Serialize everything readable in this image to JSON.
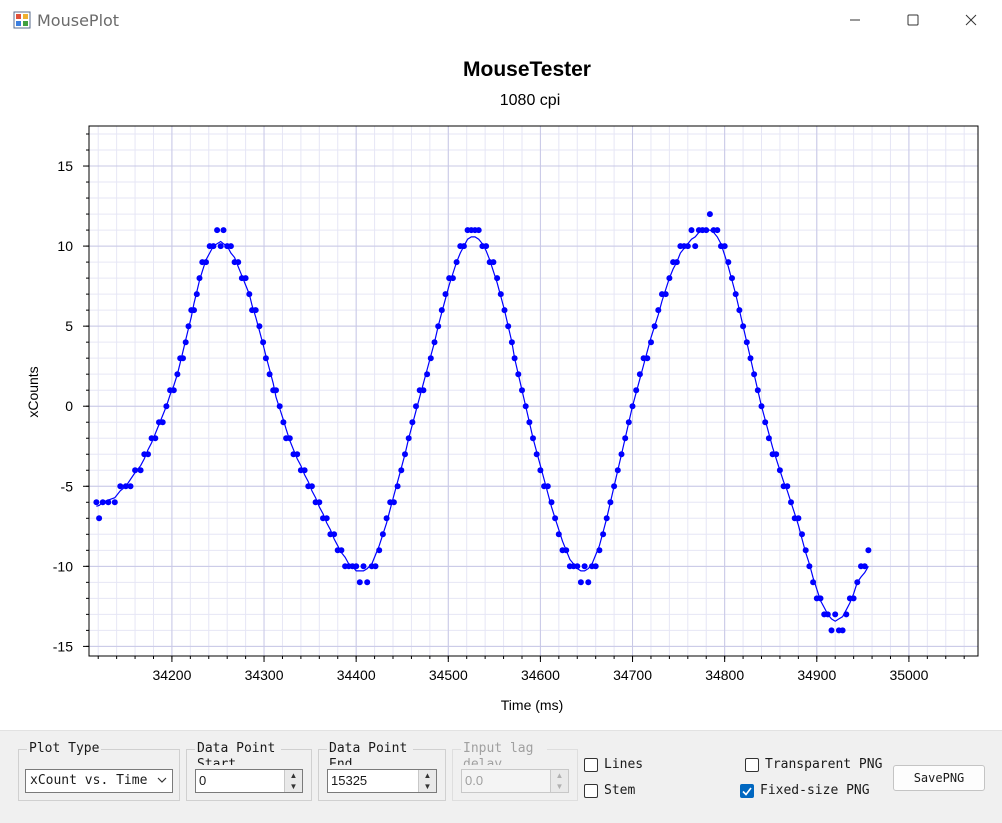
{
  "window": {
    "title": "MousePlot"
  },
  "chart_data": {
    "type": "scatter",
    "title": "MouseTester",
    "subtitle": "1080 cpi",
    "xlabel": "Time (ms)",
    "ylabel": "xCounts",
    "xlim": [
      34110,
      35075
    ],
    "ylim": [
      -15.6,
      17.5
    ],
    "xticks": [
      34200,
      34300,
      34400,
      34500,
      34600,
      34700,
      34800,
      34900,
      35000
    ],
    "yticks": [
      -15,
      -10,
      -5,
      0,
      5,
      10,
      15
    ],
    "grid": true,
    "series": [
      {
        "color": "#0000ff",
        "points": [
          [
            34118,
            -6
          ],
          [
            34121,
            -7
          ],
          [
            34125,
            -6
          ],
          [
            34131,
            -6
          ],
          [
            34138,
            -6
          ],
          [
            34144,
            -5
          ],
          [
            34150,
            -5
          ],
          [
            34155,
            -5
          ],
          [
            34160,
            -4
          ],
          [
            34166,
            -4
          ],
          [
            34170,
            -3
          ],
          [
            34174,
            -3
          ],
          [
            34178,
            -2
          ],
          [
            34182,
            -2
          ],
          [
            34186,
            -1
          ],
          [
            34190,
            -1
          ],
          [
            34194,
            0
          ],
          [
            34198,
            1
          ],
          [
            34202,
            1
          ],
          [
            34206,
            2
          ],
          [
            34209,
            3
          ],
          [
            34212,
            3
          ],
          [
            34215,
            4
          ],
          [
            34218,
            5
          ],
          [
            34221,
            6
          ],
          [
            34224,
            6
          ],
          [
            34227,
            7
          ],
          [
            34230,
            8
          ],
          [
            34233,
            9
          ],
          [
            34237,
            9
          ],
          [
            34241,
            10
          ],
          [
            34245,
            10
          ],
          [
            34249,
            11
          ],
          [
            34253,
            10
          ],
          [
            34256,
            11
          ],
          [
            34260,
            10
          ],
          [
            34264,
            10
          ],
          [
            34268,
            9
          ],
          [
            34272,
            9
          ],
          [
            34276,
            8
          ],
          [
            34280,
            8
          ],
          [
            34284,
            7
          ],
          [
            34287,
            6
          ],
          [
            34291,
            6
          ],
          [
            34295,
            5
          ],
          [
            34299,
            4
          ],
          [
            34302,
            3
          ],
          [
            34306,
            2
          ],
          [
            34310,
            1
          ],
          [
            34313,
            1
          ],
          [
            34317,
            0
          ],
          [
            34321,
            -1
          ],
          [
            34324,
            -2
          ],
          [
            34328,
            -2
          ],
          [
            34332,
            -3
          ],
          [
            34336,
            -3
          ],
          [
            34340,
            -4
          ],
          [
            34344,
            -4
          ],
          [
            34348,
            -5
          ],
          [
            34352,
            -5
          ],
          [
            34356,
            -6
          ],
          [
            34360,
            -6
          ],
          [
            34364,
            -7
          ],
          [
            34368,
            -7
          ],
          [
            34372,
            -8
          ],
          [
            34376,
            -8
          ],
          [
            34380,
            -9
          ],
          [
            34384,
            -9
          ],
          [
            34388,
            -10
          ],
          [
            34392,
            -10
          ],
          [
            34396,
            -10
          ],
          [
            34400,
            -10
          ],
          [
            34404,
            -11
          ],
          [
            34408,
            -10
          ],
          [
            34412,
            -11
          ],
          [
            34417,
            -10
          ],
          [
            34421,
            -10
          ],
          [
            34425,
            -9
          ],
          [
            34429,
            -8
          ],
          [
            34433,
            -7
          ],
          [
            34437,
            -6
          ],
          [
            34441,
            -6
          ],
          [
            34445,
            -5
          ],
          [
            34449,
            -4
          ],
          [
            34453,
            -3
          ],
          [
            34457,
            -2
          ],
          [
            34461,
            -1
          ],
          [
            34465,
            0
          ],
          [
            34469,
            1
          ],
          [
            34473,
            1
          ],
          [
            34477,
            2
          ],
          [
            34481,
            3
          ],
          [
            34485,
            4
          ],
          [
            34489,
            5
          ],
          [
            34493,
            6
          ],
          [
            34497,
            7
          ],
          [
            34501,
            8
          ],
          [
            34505,
            8
          ],
          [
            34509,
            9
          ],
          [
            34513,
            10
          ],
          [
            34517,
            10
          ],
          [
            34521,
            11
          ],
          [
            34525,
            11
          ],
          [
            34529,
            11
          ],
          [
            34533,
            11
          ],
          [
            34537,
            10
          ],
          [
            34541,
            10
          ],
          [
            34545,
            9
          ],
          [
            34549,
            9
          ],
          [
            34553,
            8
          ],
          [
            34557,
            7
          ],
          [
            34561,
            6
          ],
          [
            34565,
            5
          ],
          [
            34569,
            4
          ],
          [
            34572,
            3
          ],
          [
            34576,
            2
          ],
          [
            34580,
            1
          ],
          [
            34584,
            0
          ],
          [
            34588,
            -1
          ],
          [
            34592,
            -2
          ],
          [
            34596,
            -3
          ],
          [
            34600,
            -4
          ],
          [
            34604,
            -5
          ],
          [
            34608,
            -5
          ],
          [
            34612,
            -6
          ],
          [
            34616,
            -7
          ],
          [
            34620,
            -8
          ],
          [
            34624,
            -9
          ],
          [
            34628,
            -9
          ],
          [
            34632,
            -10
          ],
          [
            34636,
            -10
          ],
          [
            34640,
            -10
          ],
          [
            34644,
            -11
          ],
          [
            34648,
            -10
          ],
          [
            34652,
            -11
          ],
          [
            34656,
            -10
          ],
          [
            34660,
            -10
          ],
          [
            34664,
            -9
          ],
          [
            34668,
            -8
          ],
          [
            34672,
            -7
          ],
          [
            34676,
            -6
          ],
          [
            34680,
            -5
          ],
          [
            34684,
            -4
          ],
          [
            34688,
            -3
          ],
          [
            34692,
            -2
          ],
          [
            34696,
            -1
          ],
          [
            34700,
            0
          ],
          [
            34704,
            1
          ],
          [
            34708,
            2
          ],
          [
            34712,
            3
          ],
          [
            34716,
            3
          ],
          [
            34720,
            4
          ],
          [
            34724,
            5
          ],
          [
            34728,
            6
          ],
          [
            34732,
            7
          ],
          [
            34736,
            7
          ],
          [
            34740,
            8
          ],
          [
            34744,
            9
          ],
          [
            34748,
            9
          ],
          [
            34752,
            10
          ],
          [
            34756,
            10
          ],
          [
            34760,
            10
          ],
          [
            34764,
            11
          ],
          [
            34768,
            10
          ],
          [
            34772,
            11
          ],
          [
            34776,
            11
          ],
          [
            34780,
            11
          ],
          [
            34784,
            12
          ],
          [
            34788,
            11
          ],
          [
            34792,
            11
          ],
          [
            34796,
            10
          ],
          [
            34800,
            10
          ],
          [
            34804,
            9
          ],
          [
            34808,
            8
          ],
          [
            34812,
            7
          ],
          [
            34816,
            6
          ],
          [
            34820,
            5
          ],
          [
            34824,
            4
          ],
          [
            34828,
            3
          ],
          [
            34832,
            2
          ],
          [
            34836,
            1
          ],
          [
            34840,
            0
          ],
          [
            34844,
            -1
          ],
          [
            34848,
            -2
          ],
          [
            34852,
            -3
          ],
          [
            34856,
            -3
          ],
          [
            34860,
            -4
          ],
          [
            34864,
            -5
          ],
          [
            34868,
            -5
          ],
          [
            34872,
            -6
          ],
          [
            34876,
            -7
          ],
          [
            34880,
            -7
          ],
          [
            34884,
            -8
          ],
          [
            34888,
            -9
          ],
          [
            34892,
            -10
          ],
          [
            34896,
            -11
          ],
          [
            34900,
            -12
          ],
          [
            34904,
            -12
          ],
          [
            34908,
            -13
          ],
          [
            34912,
            -13
          ],
          [
            34916,
            -14
          ],
          [
            34920,
            -13
          ],
          [
            34924,
            -14
          ],
          [
            34928,
            -14
          ],
          [
            34932,
            -13
          ],
          [
            34936,
            -12
          ],
          [
            34940,
            -12
          ],
          [
            34944,
            -11
          ],
          [
            34948,
            -10
          ],
          [
            34952,
            -10
          ],
          [
            34956,
            -9
          ]
        ]
      }
    ]
  },
  "panel": {
    "plot_type": {
      "label": "Plot Type",
      "value": "xCount vs. Time"
    },
    "start": {
      "label": "Data Point Start",
      "value": "0"
    },
    "end": {
      "label": "Data Point End",
      "value": "15325"
    },
    "lag": {
      "label": "Input lag delay",
      "value": "0.0"
    },
    "lines": {
      "label": "Lines"
    },
    "stem": {
      "label": "Stem"
    },
    "transparent": {
      "label": "Transparent PNG"
    },
    "fixed": {
      "label": "Fixed-size PNG"
    },
    "save": {
      "label": "SavePNG"
    }
  }
}
